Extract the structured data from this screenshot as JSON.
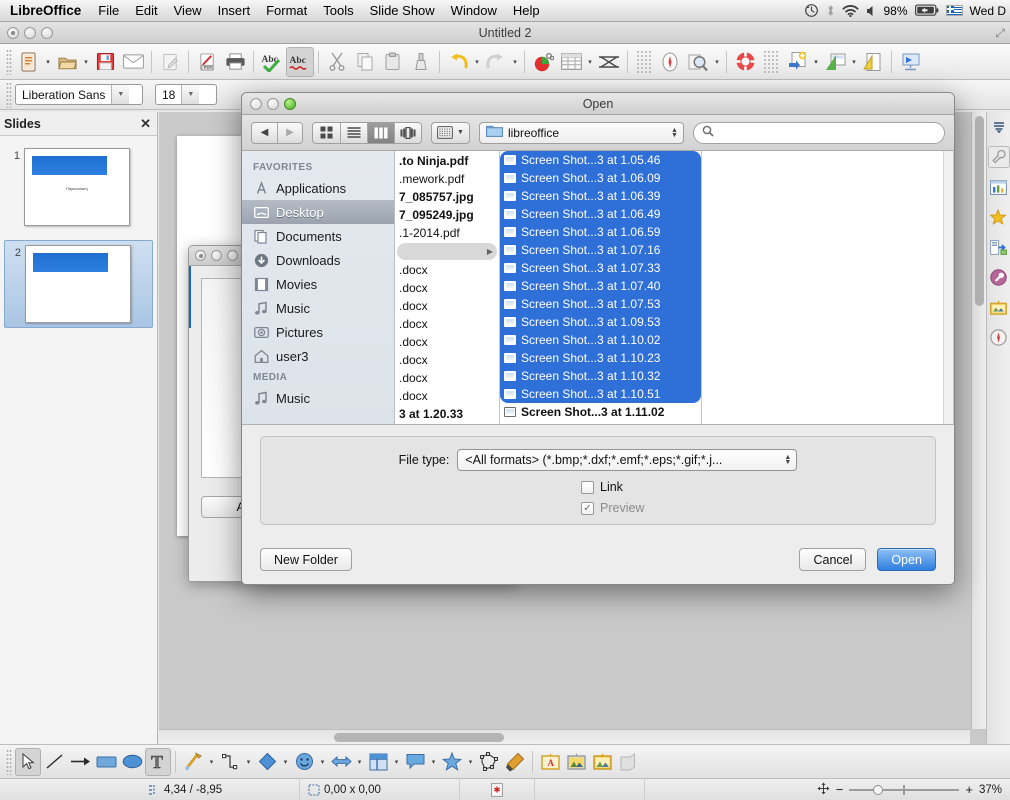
{
  "menubar": {
    "apple_label": "LibreOffice",
    "items": [
      "File",
      "Edit",
      "View",
      "Insert",
      "Format",
      "Tools",
      "Slide Show",
      "Window",
      "Help"
    ],
    "status": {
      "timemachine_icon": "time-machine-icon",
      "bluetooth_icon": "bluetooth-icon",
      "wifi_icon": "wifi-icon",
      "volume_icon": "volume-icon",
      "battery_percent": "98%",
      "battery_icon": "battery-icon",
      "input_source_icon": "greek-flag-icon",
      "clock": "Wed D"
    }
  },
  "app_window": {
    "title": "Untitled 2",
    "toolbar_icons": [
      "new-document-icon",
      "open-document-icon",
      "save-icon",
      "email-icon",
      "edit-file-icon",
      "export-pdf-icon",
      "print-icon",
      "spelling-icon",
      "autospellcheck-icon",
      "cut-icon",
      "copy-icon",
      "paste-icon",
      "clone-formatting-icon",
      "undo-icon",
      "redo-icon",
      "chart-icon",
      "table-icon",
      "display-grid-icon",
      "navigator-icon",
      "zoom-icon",
      "help-icon",
      "new-slide-icon",
      "slide-layout-icon",
      "slide-design-icon",
      "start-slideshow-icon"
    ],
    "format_bar": {
      "font_name": "Liberation Sans",
      "font_size": "18"
    }
  },
  "slides_panel": {
    "title": "Slides",
    "close_icon": "close-icon",
    "slides": [
      {
        "number": "1",
        "caption": "Παρουσίαση",
        "selected": false
      },
      {
        "number": "2",
        "caption": "",
        "selected": true
      }
    ]
  },
  "right_sidebar": {
    "items": [
      "sidebar-menu-icon",
      "properties-wrench-icon",
      "chart-panel-icon",
      "styles-star-icon",
      "slide-transition-icon",
      "custom-animation-icon",
      "gallery-icon",
      "navigator-compass-icon"
    ]
  },
  "drawing_bar": {
    "items": [
      "select-icon",
      "line-icon",
      "arrow-icon",
      "rectangle-icon",
      "ellipse-icon",
      "text-icon",
      "curve-icon",
      "connector-icon",
      "basic-shapes-icon",
      "symbol-shapes-icon",
      "block-arrows-icon",
      "flowchart-icon",
      "callout-icon",
      "star-icon",
      "points-icon",
      "fill-color-icon",
      "fontwork-icon",
      "insert-image-icon",
      "gallery-image-icon",
      "extrusion-icon"
    ]
  },
  "status_bar": {
    "cursor_position": "4,34 / -8,95",
    "object_size": "0,00 x 0,00",
    "modified_icon": "document-modified-icon",
    "fit_slide_icon": "fit-slide-icon",
    "zoom_out": "−",
    "zoom_in": "+",
    "zoom_level": "37%"
  },
  "background_window": {
    "button_label": "Ad"
  },
  "dialog": {
    "title": "Open",
    "toolbar": {
      "back_icon": "back-arrow-icon",
      "forward_icon": "forward-arrow-icon",
      "view_icon_grid": "icon-view-icon",
      "view_list": "list-view-icon",
      "view_column": "column-view-icon",
      "view_coverflow": "coverflow-view-icon",
      "action_icon": "action-gear-icon",
      "path_folder_icon": "folder-icon",
      "path_label": "libreoffice",
      "search_icon": "search-icon",
      "search_placeholder": "",
      "search_value": ""
    },
    "sidebar": {
      "groups": [
        {
          "label": "FAVORITES",
          "items": [
            {
              "label": "Applications",
              "icon": "applications-icon",
              "selected": false
            },
            {
              "label": "Desktop",
              "icon": "desktop-icon",
              "selected": true
            },
            {
              "label": "Documents",
              "icon": "documents-icon",
              "selected": false
            },
            {
              "label": "Downloads",
              "icon": "downloads-icon",
              "selected": false
            },
            {
              "label": "Movies",
              "icon": "movies-icon",
              "selected": false
            },
            {
              "label": "Music",
              "icon": "music-icon",
              "selected": false
            },
            {
              "label": "Pictures",
              "icon": "pictures-icon",
              "selected": false
            },
            {
              "label": "user3",
              "icon": "home-icon",
              "selected": false
            }
          ]
        },
        {
          "label": "MEDIA",
          "items": [
            {
              "label": "Music",
              "icon": "music-icon",
              "selected": false
            }
          ]
        }
      ]
    },
    "column1": [
      {
        "label": ".to Ninja.pdf",
        "bold": false,
        "grey": false
      },
      {
        "label": ".mework.pdf",
        "bold": false,
        "grey": false
      },
      {
        "label": "7_085757.jpg",
        "bold": true,
        "grey": false
      },
      {
        "label": "7_095249.jpg",
        "bold": true,
        "grey": false
      },
      {
        "label": ".1-2014.pdf",
        "bold": false,
        "grey": false
      },
      {
        "label": "",
        "bold": false,
        "grey": true
      },
      {
        "label": ".docx",
        "bold": false,
        "grey": false
      },
      {
        "label": ".docx",
        "bold": false,
        "grey": false
      },
      {
        "label": ".docx",
        "bold": false,
        "grey": false
      },
      {
        "label": ".docx",
        "bold": false,
        "grey": false
      },
      {
        "label": ".docx",
        "bold": false,
        "grey": false
      },
      {
        "label": ".docx",
        "bold": false,
        "grey": false
      },
      {
        "label": ".docx",
        "bold": false,
        "grey": false
      },
      {
        "label": ".docx",
        "bold": false,
        "grey": false
      },
      {
        "label": "3 at 1.20.33",
        "bold": true,
        "grey": false
      }
    ],
    "column2": [
      {
        "label": "Screen Shot...3 at 1.05.46",
        "selected": true
      },
      {
        "label": "Screen Shot...3 at 1.06.09",
        "selected": true
      },
      {
        "label": "Screen Shot...3 at 1.06.39",
        "selected": true
      },
      {
        "label": "Screen Shot...3 at 1.06.49",
        "selected": true
      },
      {
        "label": "Screen Shot...3 at 1.06.59",
        "selected": true
      },
      {
        "label": "Screen Shot...3 at 1.07.16",
        "selected": true
      },
      {
        "label": "Screen Shot...3 at 1.07.33",
        "selected": true
      },
      {
        "label": "Screen Shot...3 at 1.07.40",
        "selected": true
      },
      {
        "label": "Screen Shot...3 at 1.07.53",
        "selected": true
      },
      {
        "label": "Screen Shot...3 at 1.09.53",
        "selected": true
      },
      {
        "label": "Screen Shot...3 at 1.10.02",
        "selected": true
      },
      {
        "label": "Screen Shot...3 at 1.10.23",
        "selected": true
      },
      {
        "label": "Screen Shot...3 at 1.10.32",
        "selected": true
      },
      {
        "label": "Screen Shot...3 at 1.10.51",
        "selected": true
      },
      {
        "label": "Screen Shot...3 at 1.11.02",
        "selected": false
      }
    ],
    "options": {
      "filetype_label": "File type:",
      "filetype_value": "<All formats> (*.bmp;*.dxf;*.emf;*.eps;*.gif;*.j...",
      "link_label": "Link",
      "link_checked": false,
      "preview_label": "Preview",
      "preview_checked": true,
      "preview_disabled": true
    },
    "buttons": {
      "new_folder": "New Folder",
      "cancel": "Cancel",
      "open": "Open"
    }
  },
  "colors": {
    "selection_blue": "#2f6fd8",
    "primary_button": "#2f7fe0",
    "sidebar_selected": "#9ba3af",
    "slide_accent": "#1f6fd0"
  }
}
